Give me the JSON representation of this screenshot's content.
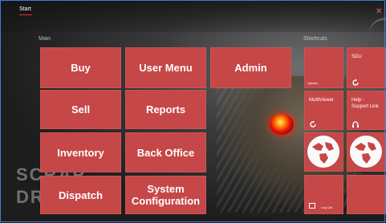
{
  "app": {
    "start_tab": "Start",
    "close_icon": "close-icon"
  },
  "sections": {
    "main": "Main",
    "shortcuts": "Shortcuts"
  },
  "main_tiles": [
    {
      "label": "Buy"
    },
    {
      "label": "User Menu"
    },
    {
      "label": "Admin"
    },
    {
      "label": "Sell"
    },
    {
      "label": "Reports"
    },
    {
      "label": "Inventory"
    },
    {
      "label": "Back Office"
    },
    {
      "label": "Dispatch"
    },
    {
      "label": "System\nConfiguration"
    }
  ],
  "shortcut_tiles": {
    "upload_label": "Upload",
    "sdu_label": "SDU",
    "multiviewer_label": "MultiViewer",
    "help_label": "Help -\nSupport Link",
    "logout_label": "Log Out"
  },
  "colors": {
    "tile_red": "#c64747",
    "accent_red": "#d93030",
    "frame_blue": "#3a7fd6"
  },
  "background_text": "SCRAP\nDR"
}
